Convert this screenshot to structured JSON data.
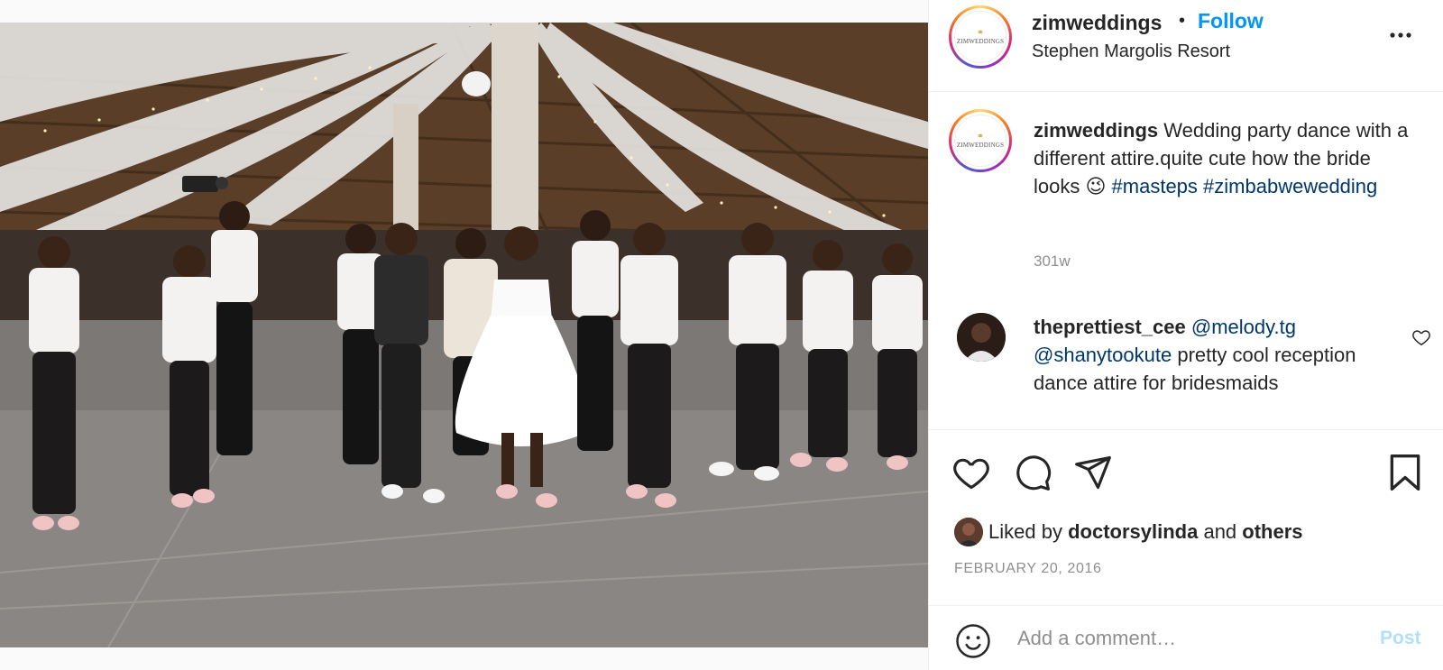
{
  "post": {
    "account": {
      "username": "zimweddings",
      "logo_text": "ZIMWEDDINGS",
      "logo_mark": "⚭",
      "follow_label": "Follow",
      "separator": "•",
      "location": "Stephen Margolis Resort",
      "more_icon": "more-options-icon"
    },
    "caption": {
      "username": "zimweddings",
      "text": "Wedding party dance with a different attire.quite cute how the bride looks 😉",
      "hashtags": [
        "#masteps",
        "#zimbabwewedding"
      ],
      "time": "301w"
    },
    "comments": [
      {
        "username": "theprettiest_cee",
        "mentions": [
          "@melody.tg",
          "@shanytookute"
        ],
        "text": "pretty cool reception dance attire for bridesmaids"
      }
    ],
    "likes": {
      "prefix": "Liked by",
      "user": "doctorsylinda",
      "conjunction": "and",
      "others": "others"
    },
    "date": "FEBRUARY 20, 2016",
    "add_comment": {
      "placeholder": "Add a comment…",
      "post_label": "Post"
    }
  },
  "colors": {
    "link_blue": "#0095f6",
    "hashtag": "#00376b",
    "muted": "#8e8e8e",
    "post_disabled": "#b2dffc",
    "text": "#262626"
  }
}
